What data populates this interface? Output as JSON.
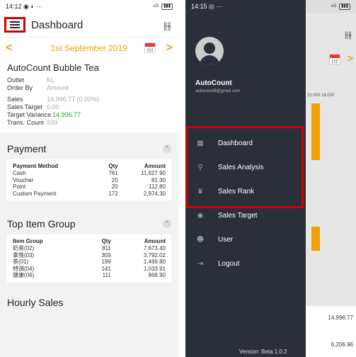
{
  "left": {
    "status": {
      "time": "14:12",
      "icons": "◉ ◐ ···",
      "signal": "⁴ᴳ"
    },
    "appbar": {
      "title": "Dashboard"
    },
    "datebar": {
      "date": "1st September 2019"
    },
    "summary": {
      "store": "AutoCount Bubble Tea",
      "outlet_label": "Outlet",
      "outlet_value": "KL",
      "orderby_label": "Order By",
      "orderby_value": "Amount",
      "sales_label": "Sales",
      "sales_value": "14,996.77 (0.00%)",
      "target_label": "Sales Target",
      "target_value": "0.00",
      "variance_label": "Target Variance",
      "variance_value": "14,996.77",
      "trans_label": "Trans. Count",
      "trans_value": "939"
    },
    "payment": {
      "title": "Payment",
      "headers": [
        "Payment Method",
        "Qty",
        "Amount"
      ],
      "rows": [
        [
          "Cash",
          "761",
          "11,827.90"
        ],
        [
          "Voucher",
          "20",
          "81.30"
        ],
        [
          "Point",
          "20",
          "112.80"
        ],
        [
          "Custom Payment",
          "172",
          "2,974.30"
        ]
      ]
    },
    "top_group": {
      "title": "Top Item Group",
      "headers": [
        "Item Group",
        "Qty",
        "Amount"
      ],
      "rows": [
        [
          "奶茶(02)",
          "811",
          "7,673.40"
        ],
        [
          "拿铁(03)",
          "359",
          "3,792.02"
        ],
        [
          "茶(01)",
          "199",
          "1,469.80"
        ],
        [
          "特调(04)",
          "141",
          "1,033.91"
        ],
        [
          "健康(06)",
          "111",
          "968.90"
        ]
      ]
    },
    "hourly": {
      "title": "Hourly Sales"
    }
  },
  "right": {
    "status": {
      "time": "14:15",
      "icons": "◎ ···",
      "signal": "⁴ᴳ"
    },
    "drawer": {
      "username": "AutoCount",
      "email": "autocount8@gmail.com",
      "items": [
        {
          "label": "Dashboard",
          "icon": "grid-icon"
        },
        {
          "label": "Sales Analysis",
          "icon": "search-chart-icon"
        },
        {
          "label": "Sales Rank",
          "icon": "rank-icon"
        },
        {
          "label": "Sales Target",
          "icon": "target-icon"
        },
        {
          "label": "User",
          "icon": "users-icon"
        },
        {
          "label": "Logout",
          "icon": "logout-icon"
        }
      ],
      "version": "Version: Beta 1.0.2"
    },
    "behind": {
      "axis": "15,000 18,000",
      "value1": "14,996.77",
      "value2": "6,206.96"
    }
  },
  "colors": {
    "accent": "#f0a000",
    "highlight": "#d40000",
    "drawer": "#2b2f3a",
    "green": "#2e9e2e"
  }
}
